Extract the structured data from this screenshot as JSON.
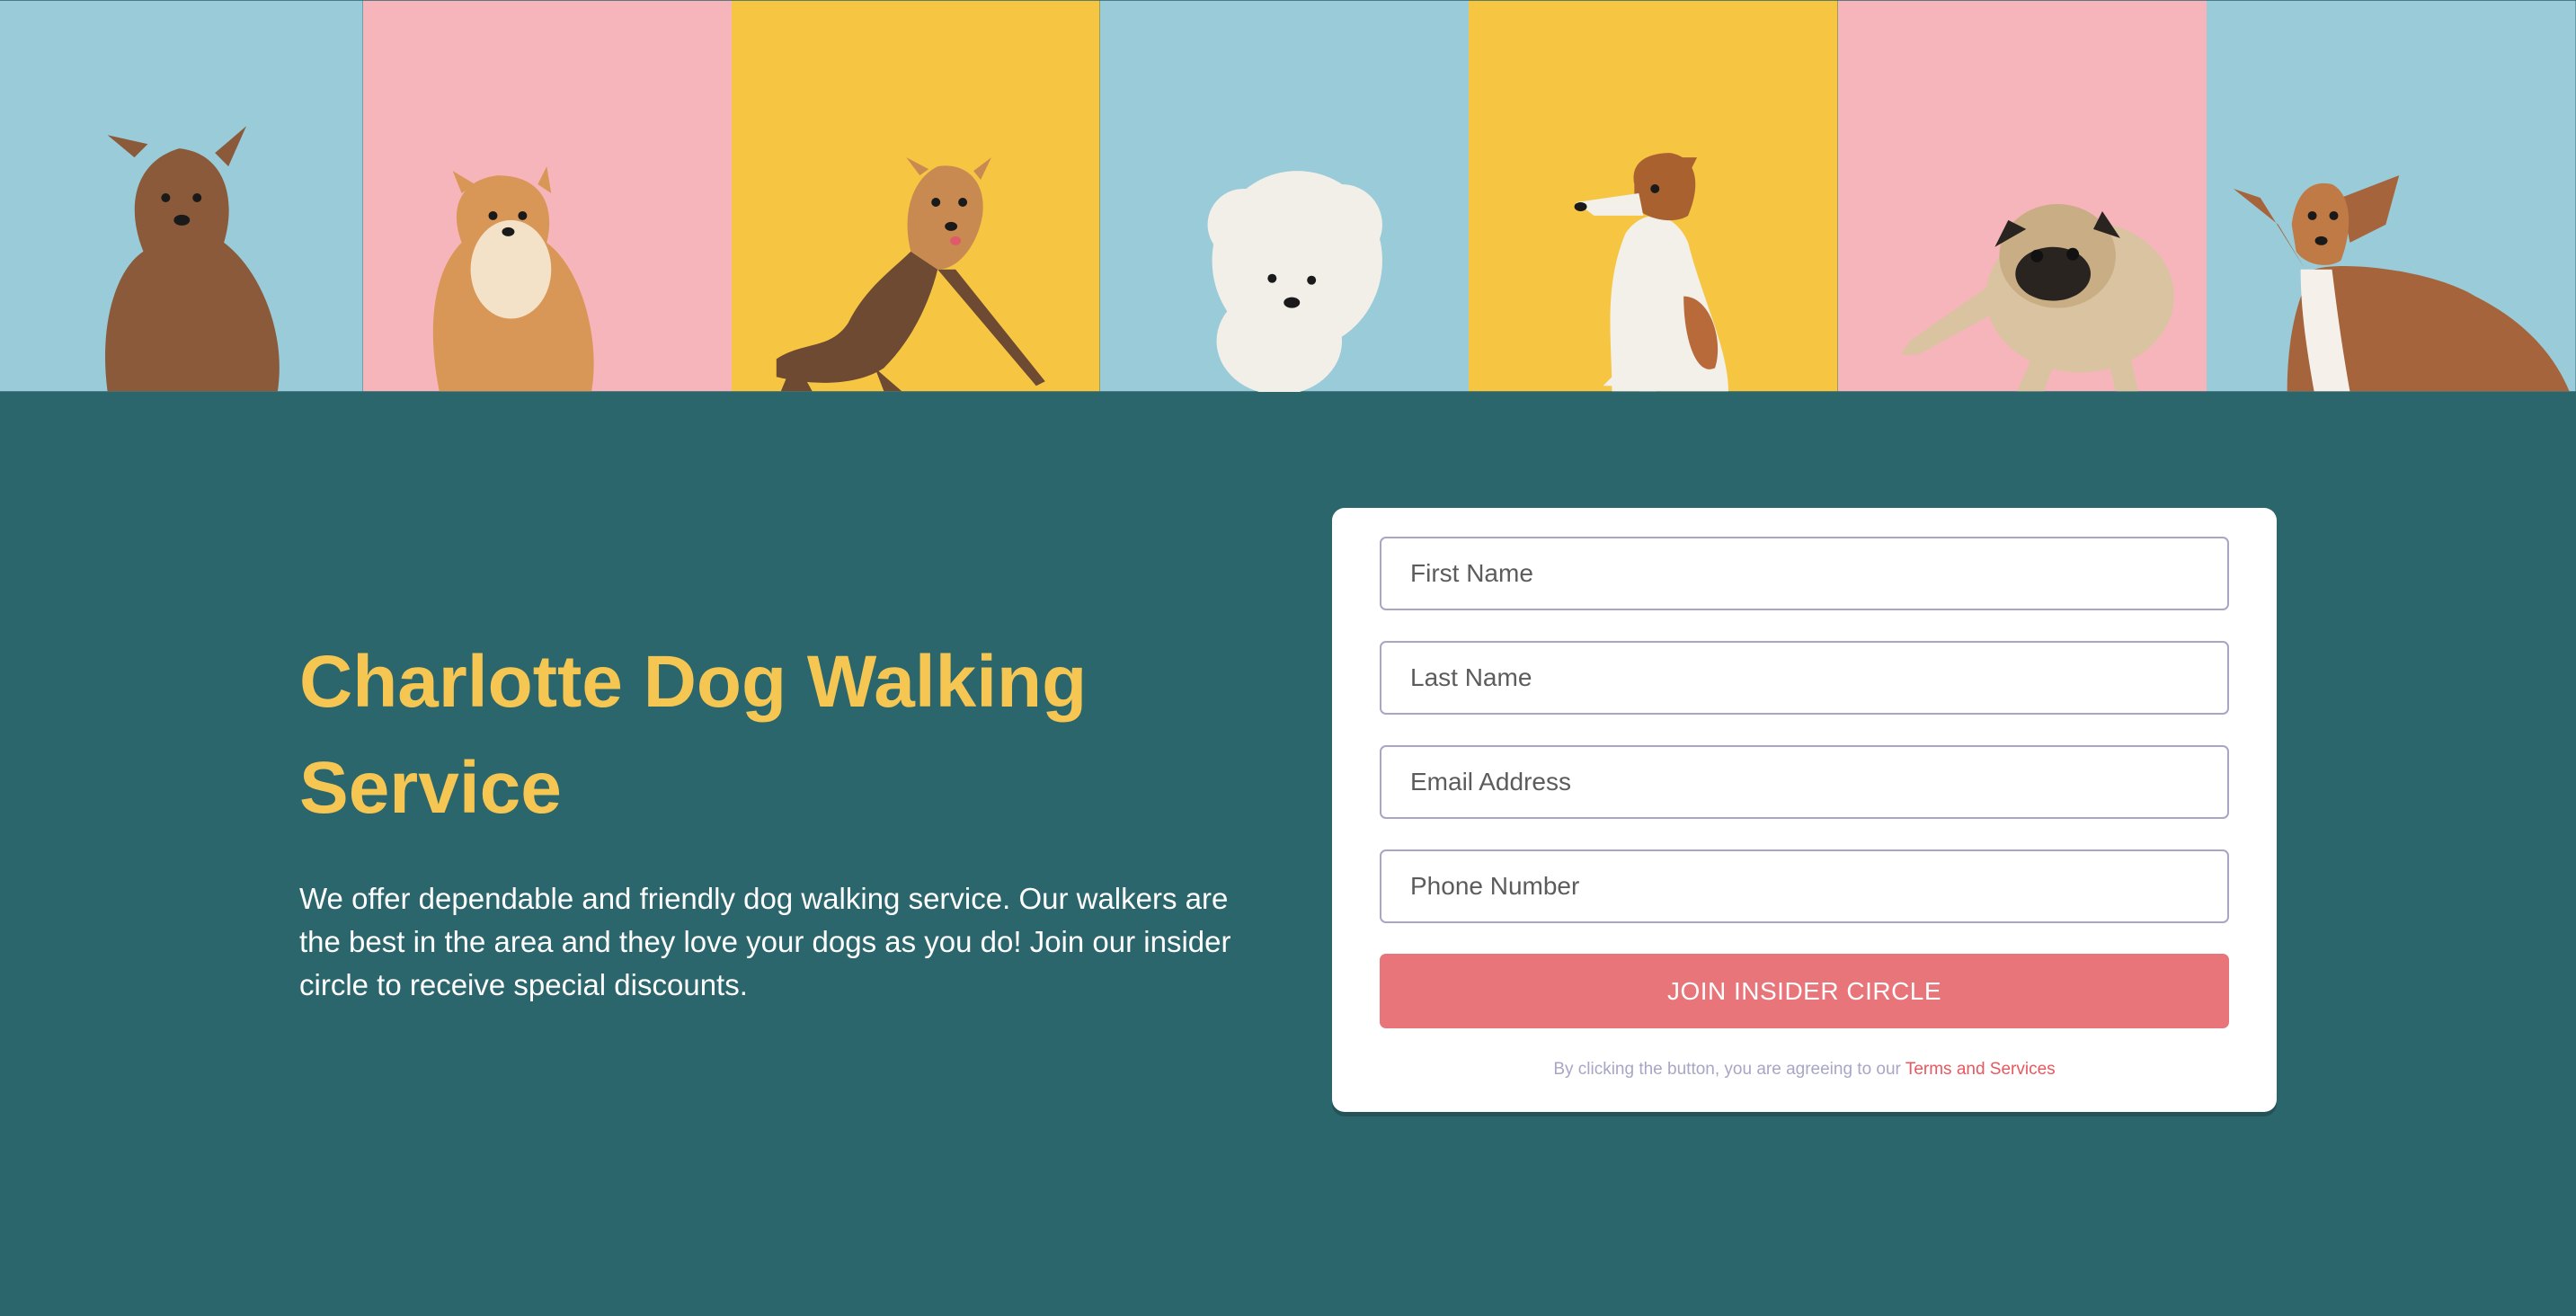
{
  "banner": {
    "panels": [
      {
        "bg": "#9acbd9",
        "dog": "yorkshire-terrier-windblown",
        "fur": "#8a5a3a"
      },
      {
        "bg": "#f6b5ba",
        "dog": "pomeranian",
        "fur": "#d99757"
      },
      {
        "bg": "#f6c643",
        "dog": "yorkshire-terrier-jumping",
        "fur": "#6e4a33"
      },
      {
        "bg": "#9acbd9",
        "dog": "bichon-frise",
        "fur": "#f2efe9"
      },
      {
        "bg": "#f6c643",
        "dog": "jack-russell-terrier",
        "fur": "#f3f0ea"
      },
      {
        "bg": "#f6b5ba",
        "dog": "pug",
        "fur": "#d9c3a1"
      },
      {
        "bg": "#9acbd9",
        "dog": "beagle",
        "fur": "#a5643b"
      }
    ]
  },
  "hero": {
    "title": "Charlotte Dog Walking Service",
    "description": "We offer dependable and friendly dog walking service. Our walkers are the best in the area and they love your dogs as you do! Join our insider circle to receive special discounts."
  },
  "form": {
    "first_name_placeholder": "First Name",
    "last_name_placeholder": "Last Name",
    "email_placeholder": "Email Address",
    "phone_placeholder": "Phone Number",
    "submit_label": "JOIN INSIDER CIRCLE",
    "terms_text": "By clicking the button, you are agreeing to our ",
    "terms_link": "Terms and Services"
  },
  "colors": {
    "page_bg": "#2b666d",
    "title": "#f6c653",
    "button": "#e8757a",
    "link": "#e8585f",
    "muted": "#a8a6c4"
  }
}
